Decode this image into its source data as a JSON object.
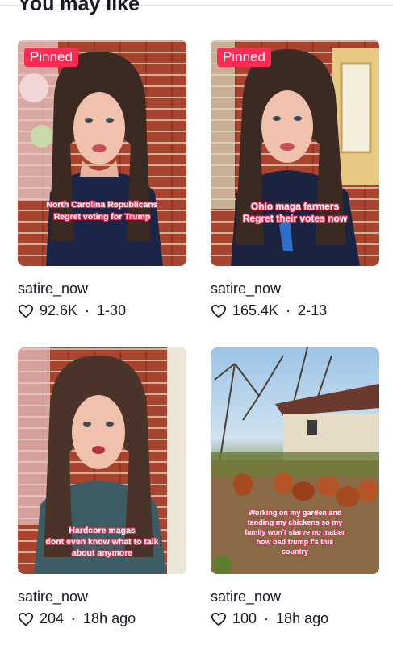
{
  "section": {
    "title": "You may like"
  },
  "cards": [
    {
      "pinned_label": "Pinned",
      "caption_line1": "North Carolina Republicans",
      "caption_line2": "Regret voting for Trump",
      "username": "satire_now",
      "likes": "92.6K",
      "date": "1-30"
    },
    {
      "pinned_label": "Pinned",
      "caption_line1": "Ohio maga farmers",
      "caption_line2": "Regret their votes now",
      "username": "satire_now",
      "likes": "165.4K",
      "date": "2-13"
    },
    {
      "caption_line1": "Hardcore magas",
      "caption_line2": "dont even know what to talk",
      "caption_line3": "about anymore",
      "username": "satire_now",
      "likes": "204",
      "date": "18h ago"
    },
    {
      "caption_line1": "Working on my garden and",
      "caption_line2": "tending my chickens so my",
      "caption_line3": "family won't starve no matter",
      "caption_line4": "how bad trump f's this",
      "caption_line5": "country",
      "username": "satire_now",
      "likes": "100",
      "date": "18h ago"
    }
  ],
  "icons": {
    "like": "heart-outline-icon"
  },
  "colors": {
    "pinned_badge": "#fe2c55",
    "text": "#161823"
  }
}
